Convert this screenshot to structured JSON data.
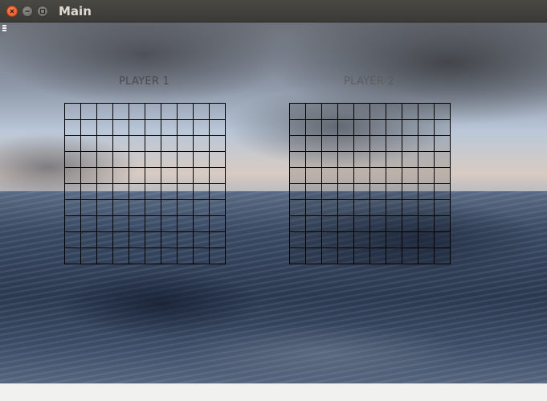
{
  "window": {
    "title": "Main",
    "controls": [
      "close-icon",
      "minimize-icon",
      "maximize-icon"
    ]
  },
  "menu": {
    "icon": "menu-icon"
  },
  "players": [
    {
      "label": "PLAYER 1",
      "board": {
        "rows": 10,
        "cols": 10
      }
    },
    {
      "label": "PLAYER 2",
      "board": {
        "rows": 10,
        "cols": 10
      }
    }
  ],
  "colors": {
    "titlebar": "#3b3a36",
    "close_button": "#e0561f",
    "grid_line": "#000000",
    "label_text": "#4a4a4a"
  }
}
